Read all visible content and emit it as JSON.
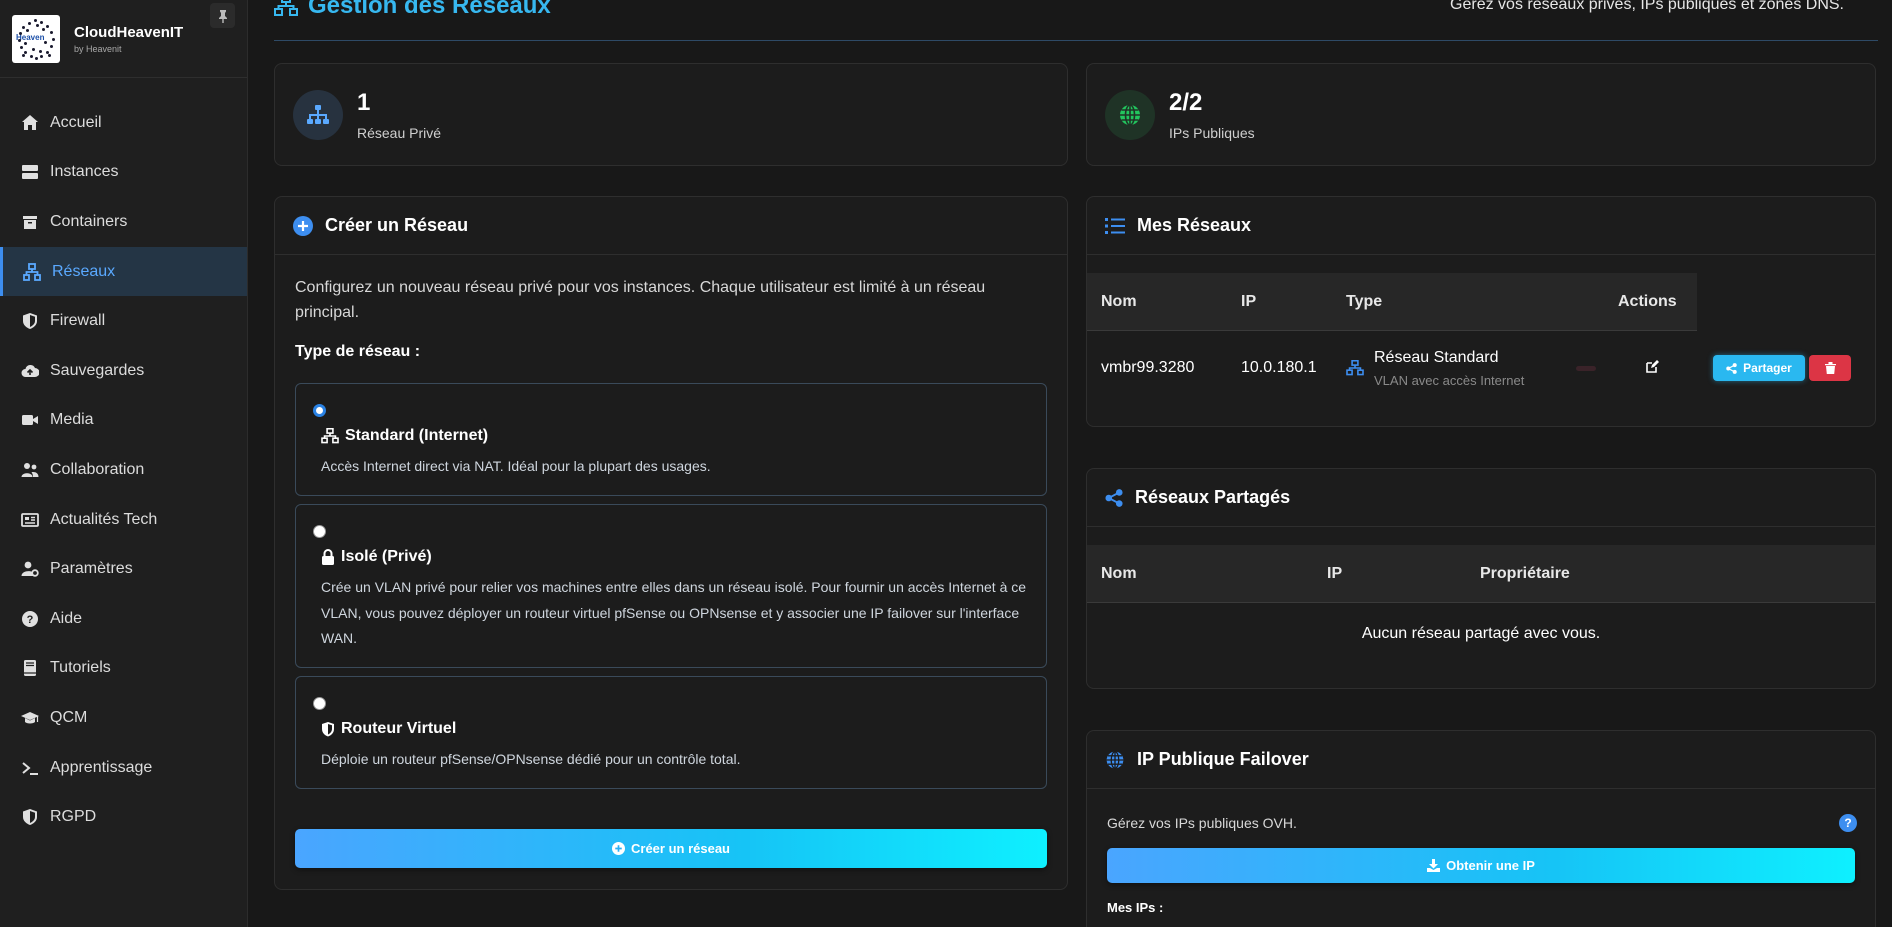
{
  "sidebar": {
    "brand_name": "CloudHeavenIT",
    "brand_sub": "by Heavenit",
    "logo_text": "Heaven",
    "items": [
      {
        "label": "Accueil",
        "icon": "home-icon"
      },
      {
        "label": "Instances",
        "icon": "server-icon"
      },
      {
        "label": "Containers",
        "icon": "box-icon"
      },
      {
        "label": "Réseaux",
        "icon": "network-icon",
        "active": true
      },
      {
        "label": "Firewall",
        "icon": "shield-icon"
      },
      {
        "label": "Sauvegardes",
        "icon": "cloud-upload-icon"
      },
      {
        "label": "Media",
        "icon": "video-icon"
      },
      {
        "label": "Collaboration",
        "icon": "users-icon"
      },
      {
        "label": "Actualités Tech",
        "icon": "newspaper-icon"
      },
      {
        "label": "Paramètres",
        "icon": "user-cog-icon"
      },
      {
        "label": "Aide",
        "icon": "question-icon"
      },
      {
        "label": "Tutoriels",
        "icon": "book-icon"
      },
      {
        "label": "QCM",
        "icon": "graduation-cap-icon"
      },
      {
        "label": "Apprentissage",
        "icon": "terminal-icon"
      },
      {
        "label": "RGPD",
        "icon": "shield-half-icon"
      }
    ]
  },
  "header": {
    "title": "Gestion des Réseaux",
    "description": "Gérez vos réseaux privés, IPs publiques et zones DNS."
  },
  "stats": {
    "private": {
      "value": "1",
      "label": "Réseau Privé"
    },
    "public": {
      "value": "2/2",
      "label": "IPs Publiques"
    }
  },
  "create": {
    "title": "Créer un Réseau",
    "intro": "Configurez un nouveau réseau privé pour vos instances. Chaque utilisateur est limité à un réseau principal.",
    "type_label": "Type de réseau :",
    "options": [
      {
        "title": "Standard (Internet)",
        "desc": "Accès Internet direct via NAT. Idéal pour la plupart des usages.",
        "selected": true
      },
      {
        "title": "Isolé (Privé)",
        "desc": "Crée un VLAN privé pour relier vos machines entre elles dans un réseau isolé. Pour fournir un accès Internet à ce VLAN, vous pouvez déployer un routeur virtuel pfSense ou OPNsense et y associer une IP failover sur l'interface WAN.",
        "selected": false
      },
      {
        "title": "Routeur Virtuel",
        "desc": "Déploie un routeur pfSense/OPNsense dédié pour un contrôle total.",
        "selected": false
      }
    ],
    "button": "Créer un réseau"
  },
  "my_networks": {
    "title": "Mes Réseaux",
    "columns": [
      "Nom",
      "IP",
      "Type",
      "Actions"
    ],
    "rows": [
      {
        "name": "vmbr99.3280",
        "ip": "10.0.180.1",
        "type": "Réseau Standard",
        "type_sub": "VLAN avec accès Internet",
        "share": "Partager"
      }
    ]
  },
  "shared": {
    "title": "Réseaux Partagés",
    "columns": [
      "Nom",
      "IP",
      "Propriétaire"
    ],
    "empty": "Aucun réseau partagé avec vous."
  },
  "failover": {
    "title": "IP Publique Failover",
    "desc": "Gérez vos IPs publiques OVH.",
    "button": "Obtenir une IP",
    "my_ips": "Mes IPs :"
  },
  "colors": {
    "accent": "#37b8f0",
    "primary": "#3d8ef0",
    "danger": "#dc3545",
    "success": "#22c55e"
  }
}
